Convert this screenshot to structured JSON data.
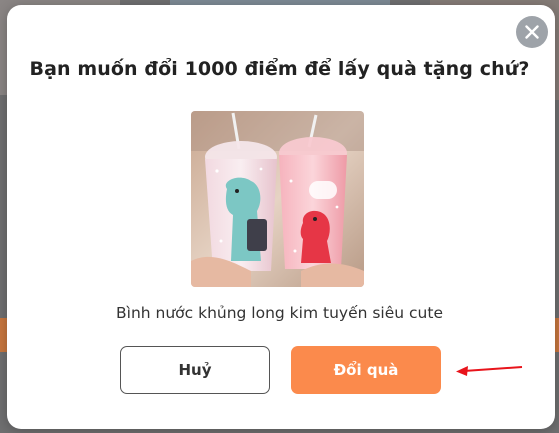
{
  "dialog": {
    "title": "Bạn muốn đổi 1000 điểm để lấy quà tặng chứ?",
    "close_icon": "close-icon",
    "product": {
      "image_icon": "tumbler-cups-image",
      "name": "Bình nước khủng long kim tuyến siêu cute"
    },
    "buttons": {
      "cancel_label": "Huỷ",
      "redeem_label": "Đổi quà"
    }
  },
  "colors": {
    "accent": "#fb8a4c",
    "close_bg": "#9ea3a9",
    "backdrop": "#6f6f70",
    "annotation_arrow": "#e8141b"
  }
}
